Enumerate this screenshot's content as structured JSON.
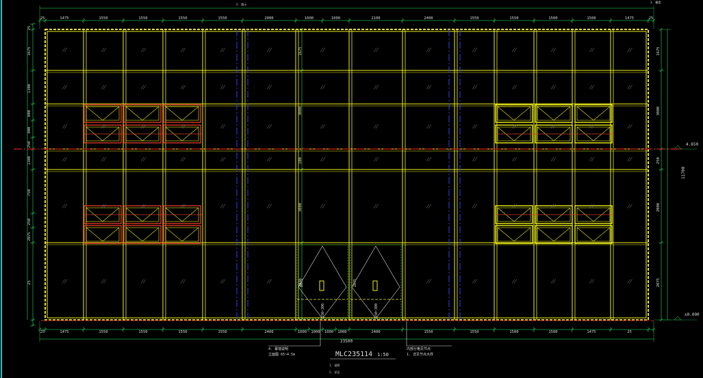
{
  "colors": {
    "background": "#000000",
    "frame": "#e8e040",
    "mullion": "#f2f21a",
    "dim": "#18a848",
    "text": "#dddddd",
    "floor_line": "#d81f1f",
    "axis": "#2a40ff",
    "window_red": "#d83a2a",
    "cyan_border": "#20c4c4"
  },
  "top_dims": [
    "25",
    "1475",
    "1550",
    "1550",
    "1550",
    "1550",
    "2000",
    "1000",
    "1000",
    "2100",
    "2400",
    "1550",
    "1550",
    "1500",
    "1500",
    "1475",
    "25"
  ],
  "bottom_dims": [
    "25",
    "1475",
    "1550",
    "1550",
    "1550",
    "1550",
    "2400",
    "1000",
    "1000",
    "1000",
    "1000",
    "2400",
    "1550",
    "1550",
    "1500",
    "1500",
    "1475",
    "25"
  ],
  "total_width": "23500",
  "left_dims": [
    "25",
    "1675",
    "1300",
    "800",
    "900",
    "250",
    "1100",
    "750",
    "250",
    "2075",
    "25"
  ],
  "mid_dims": [
    "1675",
    "3000",
    "100",
    "3000",
    "2075"
  ],
  "right_dims": [
    "1675",
    "3000",
    "250",
    "2000",
    "2075"
  ],
  "right_total": "11700",
  "levels": [
    "4.650",
    "±0.000"
  ],
  "door_notes": [
    "2075",
    "150~300"
  ],
  "drawing_title": "MLC235114",
  "scale": "1:50",
  "top_notes": [
    "2. 图示",
    "3. 幕墙"
  ],
  "left_callout": [
    "4. 幕墙说明",
    "立面图 65~4.5m"
  ],
  "right_callout": [
    "内部分格见节点",
    "1. 详见节点大样"
  ],
  "bottom_notes": [
    "1. 说明",
    "2. 详见"
  ]
}
